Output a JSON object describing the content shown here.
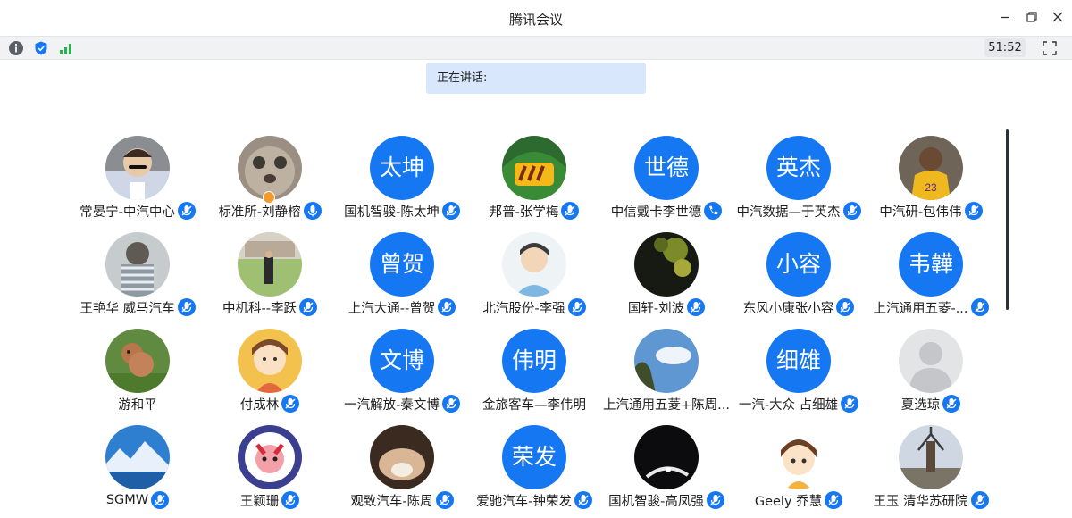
{
  "window": {
    "title": "腾讯会议"
  },
  "toolbar": {
    "timer": "51:52"
  },
  "speaking": {
    "label": "正在讲话:"
  },
  "colors": {
    "accent": "#1677f2",
    "speaking_bg": "#d8e7fc",
    "toolbar_bg": "#f1f2f4"
  },
  "participants": [
    {
      "name": "常晏宁-中汽中心",
      "avatar": "photo",
      "mic": "muted"
    },
    {
      "name": "标准所-刘静榕",
      "avatar": "photo",
      "mic": "on"
    },
    {
      "name": "国机智骏-陈太坤",
      "avatar": "太坤",
      "mic": "muted"
    },
    {
      "name": "邦普-张学梅",
      "avatar": "photo",
      "mic": "muted"
    },
    {
      "name": "中信戴卡李世德",
      "avatar": "世德",
      "mic": "phone"
    },
    {
      "name": "中汽数据—于英杰",
      "avatar": "英杰",
      "mic": "muted"
    },
    {
      "name": "中汽研-包伟伟",
      "avatar": "photo",
      "mic": "muted"
    },
    {
      "name": "王艳华 威马汽车",
      "avatar": "photo",
      "mic": "muted"
    },
    {
      "name": "中机科--李跃",
      "avatar": "photo",
      "mic": "muted"
    },
    {
      "name": "上汽大通--曾贺",
      "avatar": "曾贺",
      "mic": "muted"
    },
    {
      "name": "北汽股份-李强",
      "avatar": "photo",
      "mic": "muted"
    },
    {
      "name": "国轩-刘波",
      "avatar": "photo",
      "mic": "muted"
    },
    {
      "name": "东风小康张小容",
      "avatar": "小容",
      "mic": "muted"
    },
    {
      "name": "上汽通用五菱-...",
      "avatar": "韦韡",
      "mic": "muted"
    },
    {
      "name": "游和平",
      "avatar": "photo",
      "mic": "none"
    },
    {
      "name": "付成林",
      "avatar": "photo",
      "mic": "muted"
    },
    {
      "name": "一汽解放-秦文博",
      "avatar": "文博",
      "mic": "muted"
    },
    {
      "name": "金旅客车—李伟明",
      "avatar": "伟明",
      "mic": "none"
    },
    {
      "name": "上汽通用五菱+陈周...",
      "avatar": "photo",
      "mic": "none"
    },
    {
      "name": "一汽-大众 占细雄",
      "avatar": "细雄",
      "mic": "muted"
    },
    {
      "name": "夏选琼",
      "avatar": "photo",
      "mic": "muted"
    },
    {
      "name": "SGMW",
      "avatar": "photo",
      "mic": "muted"
    },
    {
      "name": "王颖珊",
      "avatar": "photo",
      "mic": "muted"
    },
    {
      "name": "观致汽车-陈周",
      "avatar": "photo",
      "mic": "muted"
    },
    {
      "name": "爱驰汽车-钟荣发",
      "avatar": "荣发",
      "mic": "muted"
    },
    {
      "name": "国机智骏-高凤强",
      "avatar": "photo",
      "mic": "muted"
    },
    {
      "name": "Geely 乔慧",
      "avatar": "photo",
      "mic": "muted"
    },
    {
      "name": "王玉 清华苏研院",
      "avatar": "photo",
      "mic": "muted"
    }
  ]
}
